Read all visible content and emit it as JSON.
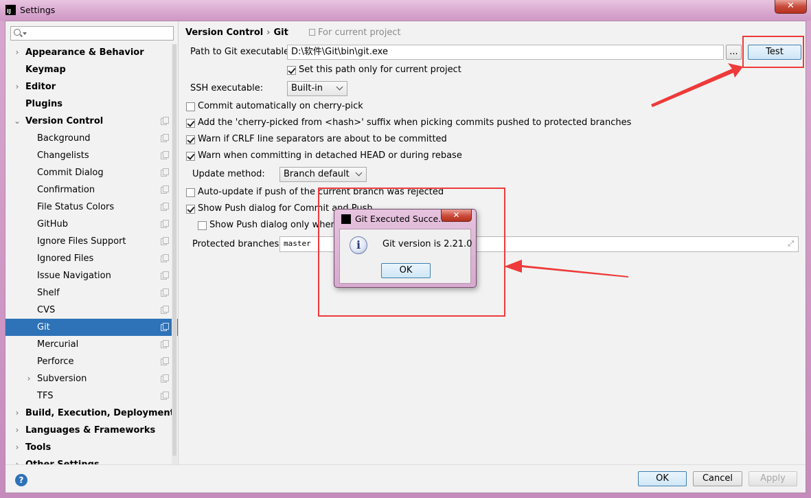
{
  "window": {
    "title": "Settings",
    "close_glyph": "✕"
  },
  "search": {
    "placeholder": ""
  },
  "tree": [
    {
      "label": "Appearance & Behavior",
      "arrow": "›",
      "bold": true
    },
    {
      "label": "Keymap",
      "bold": true
    },
    {
      "label": "Editor",
      "arrow": "›",
      "bold": true
    },
    {
      "label": "Plugins",
      "bold": true
    },
    {
      "label": "Version Control",
      "arrow": "⌄",
      "bold": true,
      "project_icon": true
    },
    {
      "label": "Background",
      "child": true,
      "project_icon": true
    },
    {
      "label": "Changelists",
      "child": true,
      "project_icon": true
    },
    {
      "label": "Commit Dialog",
      "child": true,
      "project_icon": true
    },
    {
      "label": "Confirmation",
      "child": true,
      "project_icon": true
    },
    {
      "label": "File Status Colors",
      "child": true,
      "project_icon": true
    },
    {
      "label": "GitHub",
      "child": true,
      "project_icon": true
    },
    {
      "label": "Ignore Files Support",
      "child": true,
      "project_icon": true
    },
    {
      "label": "Ignored Files",
      "child": true,
      "project_icon": true
    },
    {
      "label": "Issue Navigation",
      "child": true,
      "project_icon": true
    },
    {
      "label": "Shelf",
      "child": true,
      "project_icon": true
    },
    {
      "label": "CVS",
      "child": true,
      "project_icon": true
    },
    {
      "label": "Git",
      "child": true,
      "project_icon": true,
      "selected": true
    },
    {
      "label": "Mercurial",
      "child": true,
      "project_icon": true
    },
    {
      "label": "Perforce",
      "child": true,
      "project_icon": true
    },
    {
      "label": "Subversion",
      "child": true,
      "arrow": "›",
      "project_icon": true
    },
    {
      "label": "TFS",
      "child": true,
      "project_icon": true
    },
    {
      "label": "Build, Execution, Deployment",
      "arrow": "›",
      "bold": true
    },
    {
      "label": "Languages & Frameworks",
      "arrow": "›",
      "bold": true
    },
    {
      "label": "Tools",
      "arrow": "›",
      "bold": true
    },
    {
      "label": "Other Settings",
      "arrow": "›",
      "bold": true
    }
  ],
  "header": {
    "crumb_parent": "Version Control",
    "crumb_sep": "›",
    "crumb_current": "Git",
    "scope": "For current project"
  },
  "git": {
    "path_label": "Path to Git executable:",
    "path_value": "D:\\软件\\Git\\bin\\git.exe",
    "browse_label": "...",
    "test_label": "Test",
    "set_path_only": {
      "label": "Set this path only for current project",
      "checked": true
    },
    "ssh_label": "SSH executable:",
    "ssh_value": "Built-in",
    "options": [
      {
        "label": "Commit automatically on cherry-pick",
        "checked": false
      },
      {
        "label": "Add the 'cherry-picked from <hash>' suffix when picking commits pushed to protected branches",
        "checked": true
      },
      {
        "label": "Warn if CRLF line separators are about to be committed",
        "checked": true
      },
      {
        "label": "Warn when committing in detached HEAD or during rebase",
        "checked": true
      }
    ],
    "update_method_label": "Update method:",
    "update_method_value": "Branch default",
    "auto_update": {
      "label": "Auto-update if push of the current branch was rejected",
      "checked": false
    },
    "show_push": {
      "label": "Show Push dialog for Commit and Push",
      "checked": true
    },
    "show_push_protected": {
      "label": "Show Push dialog only when co",
      "checked": false
    },
    "protected_label": "Protected branches:",
    "protected_value": "master",
    "expand_glyph": "⤢"
  },
  "dialog": {
    "title": "Git Executed Succe...",
    "close_glyph": "✕",
    "icon_glyph": "i",
    "message": "Git version is 2.21.0",
    "ok_label": "OK"
  },
  "footer": {
    "help_glyph": "?",
    "ok_label": "OK",
    "cancel_label": "Cancel",
    "apply_label": "Apply"
  },
  "colors": {
    "selection": "#2e72b8",
    "annotation": "#ee3a3a",
    "frame": "#d8a8cf"
  }
}
